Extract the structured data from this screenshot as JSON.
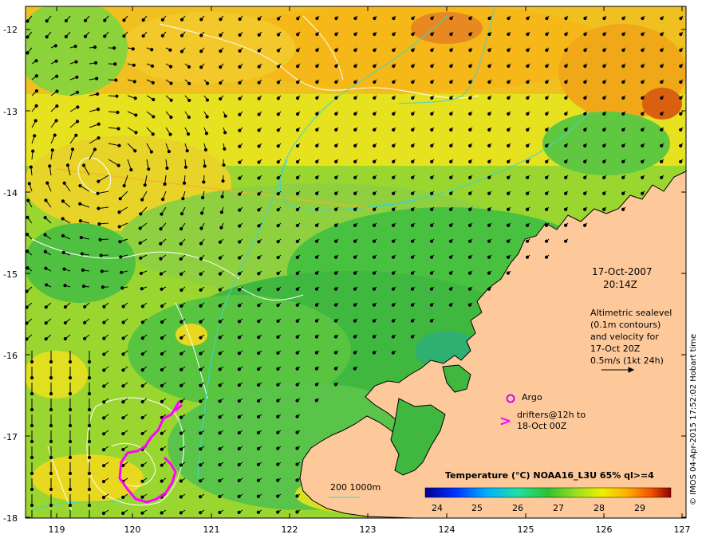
{
  "map": {
    "y_ticks": [
      "-12",
      "-13",
      "-14",
      "-15",
      "-16",
      "-17",
      "-18"
    ],
    "x_ticks": [
      "119",
      "120",
      "121",
      "122",
      "123",
      "124",
      "125",
      "126",
      "127"
    ],
    "date": "17-Oct-2007",
    "time": "20:14Z",
    "altimetry_lines": [
      "Altimetric sealevel",
      "(0.1m contours)",
      "and velocity for",
      "17-Oct 20Z",
      "0.5m/s (1kt 24h)"
    ],
    "argo_label": "Argo",
    "drifters_line1": "drifters@12h to",
    "drifters_line2": "18-Oct 00Z",
    "drifter_symbol": ">",
    "bathymetry_label": "200  1000m",
    "colorbar_title": "Temperature (°C) NOAA16_L3U 65% ql>=4",
    "colorbar_ticks": [
      "24",
      "25",
      "26",
      "27",
      "28",
      "29"
    ],
    "credit": "© IMOS 04-Apr-2015 17:52:02 Hobart time",
    "colors": {
      "land": "#fdc99a",
      "contour": "#ffffff",
      "bathymetry": "#3ad6d0",
      "drifter": "#ff00ff",
      "argo": "#d000ff"
    }
  }
}
